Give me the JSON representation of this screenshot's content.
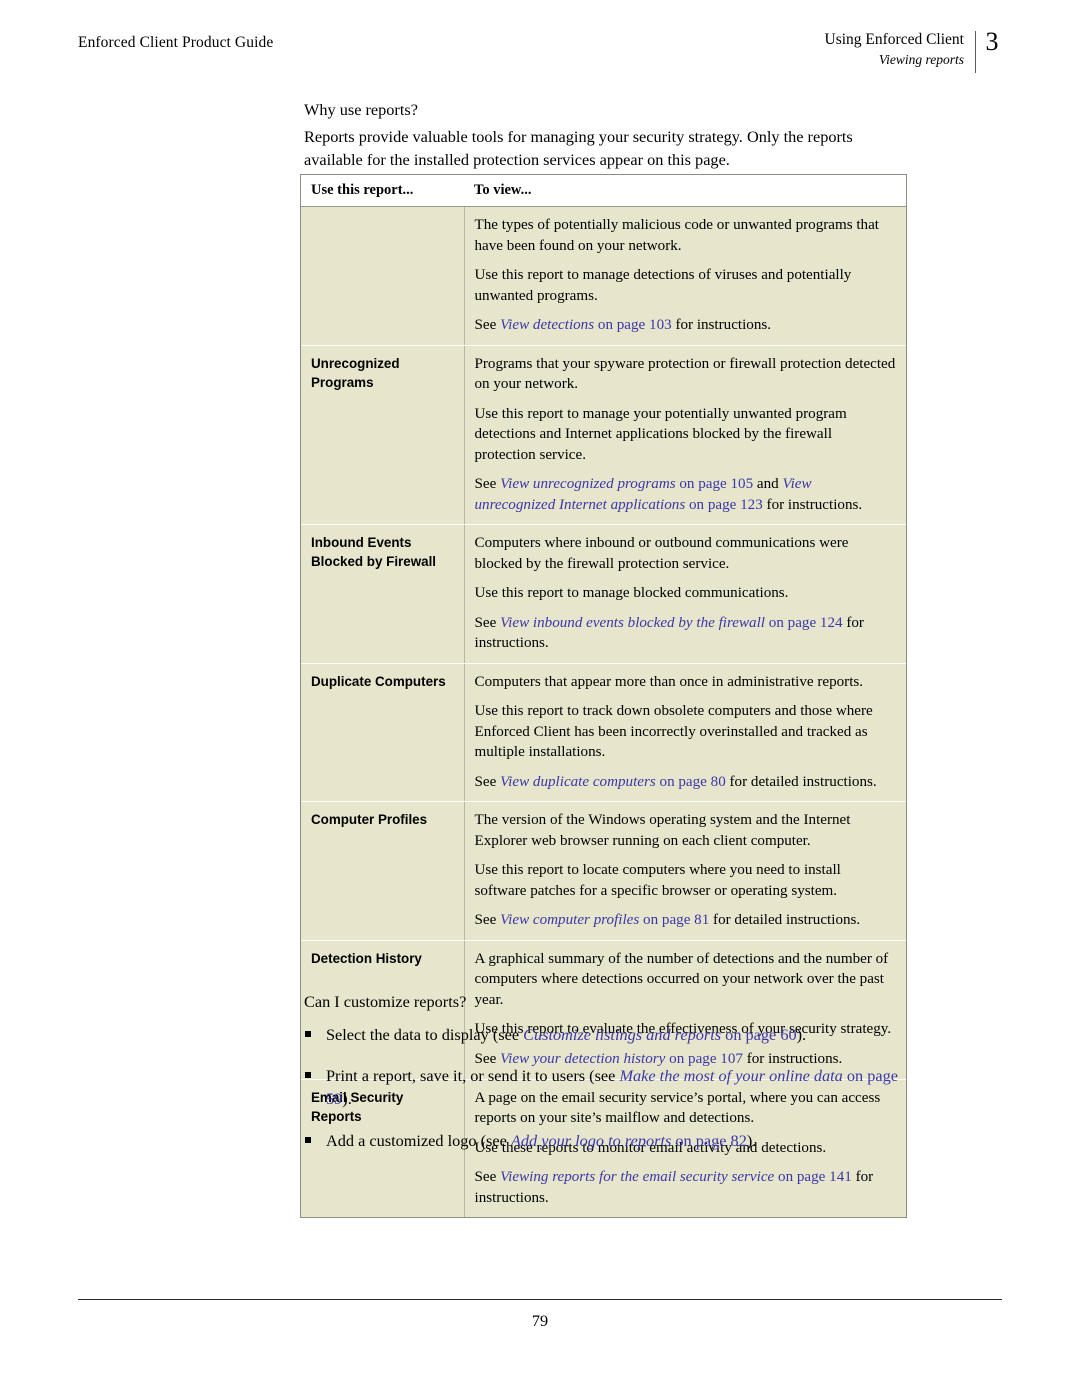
{
  "header": {
    "left_title": "Enforced Client Product Guide",
    "chapter_title": "Using Enforced Client",
    "section_title": "Viewing reports",
    "chapter_number": "3"
  },
  "intro": {
    "question": "Why use reports?",
    "body": "Reports provide valuable tools for managing your security strategy. Only the reports available for the installed protection services appear on this page."
  },
  "table": {
    "columns": [
      "Use this report...",
      "To view..."
    ],
    "rows": [
      {
        "label": "",
        "paragraphs": [
          "The types of potentially malicious code or unwanted programs that have been found on your network.",
          "Use this report to manage detections of viruses and potentially unwanted programs."
        ],
        "see_prefix": "See ",
        "refs": [
          {
            "title": "View detections",
            "page": "on page 103"
          }
        ],
        "see_suffix": " for instructions."
      },
      {
        "label": "Unrecognized Programs",
        "paragraphs": [
          "Programs that your spyware protection or firewall protection detected on your network.",
          "Use this report to manage your potentially unwanted program detections and Internet applications blocked by the firewall protection service."
        ],
        "see_prefix": "See ",
        "refs": [
          {
            "title": "View unrecognized programs",
            "page": "on page 105"
          },
          {
            "title": "View unrecognized Internet applications",
            "page": "on page 123"
          }
        ],
        "ref_joiner": " and ",
        "see_suffix": " for instructions."
      },
      {
        "label": "Inbound Events Blocked by Firewall",
        "paragraphs": [
          "Computers where inbound or outbound communications were blocked by the firewall protection service.",
          "Use this report to manage blocked communications."
        ],
        "see_prefix": "See ",
        "refs": [
          {
            "title": "View inbound events blocked by the firewall",
            "page": "on page 124"
          }
        ],
        "see_suffix": " for instructions."
      },
      {
        "label": "Duplicate Computers",
        "paragraphs": [
          "Computers that appear more than once in administrative reports.",
          "Use this report to track down obsolete computers and those where Enforced Client has been incorrectly overinstalled and tracked as multiple installations."
        ],
        "see_prefix": "See ",
        "refs": [
          {
            "title": "View duplicate computers",
            "page": "on page 80"
          }
        ],
        "see_suffix": " for detailed instructions."
      },
      {
        "label": "Computer Profiles",
        "paragraphs": [
          "The version of the Windows operating system and the Internet Explorer web browser running on each client computer.",
          "Use this report to locate computers where you need to install software patches for a specific browser or operating system."
        ],
        "see_prefix": "See ",
        "refs": [
          {
            "title": "View computer profiles",
            "page": "on page 81"
          }
        ],
        "see_suffix": " for detailed instructions."
      },
      {
        "label": "Detection History",
        "paragraphs": [
          "A graphical summary of the number of detections and the number of computers where detections occurred on your network over the past year.",
          "Use this report to evaluate the effectiveness of your security strategy."
        ],
        "see_prefix": "See ",
        "refs": [
          {
            "title": "View your detection history",
            "page": "on page 107"
          }
        ],
        "see_suffix": " for instructions."
      },
      {
        "label": "Email Security Reports",
        "paragraphs": [
          "A page on the email security service’s portal, where you can access reports on your site’s mailflow and detections.",
          "Use these reports to monitor email activity and detections."
        ],
        "see_prefix": "See ",
        "refs": [
          {
            "title": "Viewing reports for the email security service",
            "page": "on page 141"
          }
        ],
        "see_suffix": " for instructions."
      }
    ]
  },
  "tail": {
    "question": "Can I customize reports?",
    "bullets": [
      {
        "before": "Select the data to display (see ",
        "ref_title": "Customize listings and reports",
        "ref_page": "on page 60",
        "after": ")."
      },
      {
        "before": "Print a report, save it, or send it to users (see ",
        "ref_title": "Make the most of your online data",
        "ref_page": "on page 59",
        "after": ")."
      },
      {
        "before": "Add a customized logo (see ",
        "ref_title": "Add your logo to reports",
        "ref_page": "on page 82",
        "after": ")."
      }
    ]
  },
  "footer": {
    "page_number": "79"
  }
}
